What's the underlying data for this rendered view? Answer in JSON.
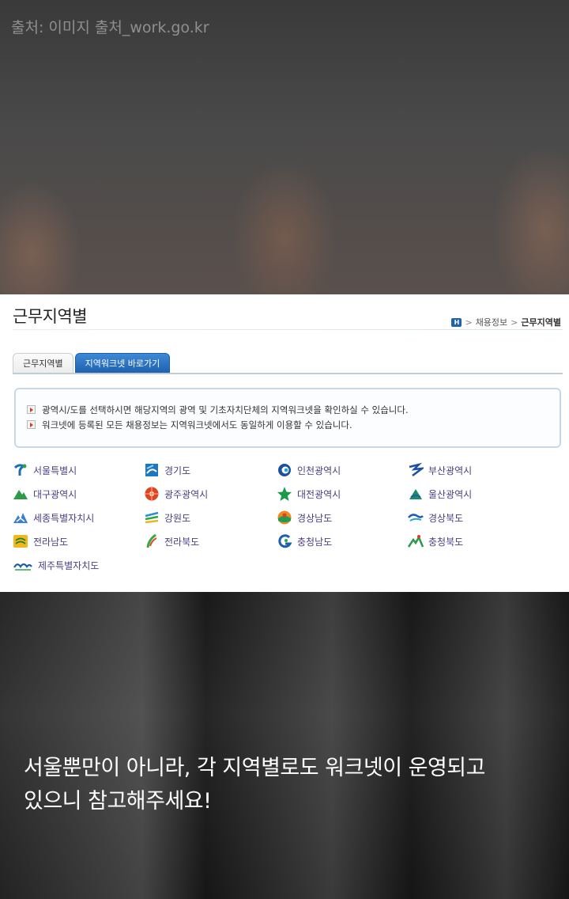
{
  "source_credit": "출처: 이미지 출처_work.go.kr",
  "panel": {
    "page_title": "근무지역별",
    "breadcrumb": {
      "home_icon": "H",
      "separator": ">",
      "items": [
        "채용정보",
        "근무지역별"
      ]
    },
    "tabs": [
      {
        "label": "근무지역별",
        "active": false
      },
      {
        "label": "지역워크넷 바로가기",
        "active": true
      }
    ],
    "info_lines": [
      "광역시/도를 선택하시면 해당지역의 광역 및 기초자치단체의 지역워크넷을 확인하실 수 있습니다.",
      "워크넷에 등록된 모든 채용정보는 지역워크넷에서도 동일하게 이용할 수 있습니다."
    ],
    "regions": [
      {
        "label": "서울특별시",
        "icon": "seoul-emblem-icon"
      },
      {
        "label": "경기도",
        "icon": "gyeonggi-emblem-icon"
      },
      {
        "label": "인천광역시",
        "icon": "incheon-emblem-icon"
      },
      {
        "label": "부산광역시",
        "icon": "busan-emblem-icon"
      },
      {
        "label": "대구광역시",
        "icon": "daegu-emblem-icon"
      },
      {
        "label": "광주광역시",
        "icon": "gwangju-emblem-icon"
      },
      {
        "label": "대전광역시",
        "icon": "daejeon-emblem-icon"
      },
      {
        "label": "울산광역시",
        "icon": "ulsan-emblem-icon"
      },
      {
        "label": "세종특별자치시",
        "icon": "sejong-emblem-icon"
      },
      {
        "label": "강원도",
        "icon": "gangwon-emblem-icon"
      },
      {
        "label": "경상남도",
        "icon": "gyeongnam-emblem-icon"
      },
      {
        "label": "경상북도",
        "icon": "gyeongbuk-emblem-icon"
      },
      {
        "label": "전라남도",
        "icon": "jeonnam-emblem-icon"
      },
      {
        "label": "전라북도",
        "icon": "jeonbuk-emblem-icon"
      },
      {
        "label": "충청남도",
        "icon": "chungnam-emblem-icon"
      },
      {
        "label": "충청북도",
        "icon": "chungbuk-emblem-icon"
      },
      {
        "label": "제주특별자치도",
        "icon": "jeju-emblem-icon"
      }
    ]
  },
  "caption_lines": [
    "서울뿐만이 아니라, 각 지역별로도 워크넷이 운영되고",
    "있으니 참고해주세요!"
  ],
  "colors": {
    "tab_active": "#1d5fae",
    "region_text": "#4b3f80",
    "caption_text": "#ffffff"
  }
}
